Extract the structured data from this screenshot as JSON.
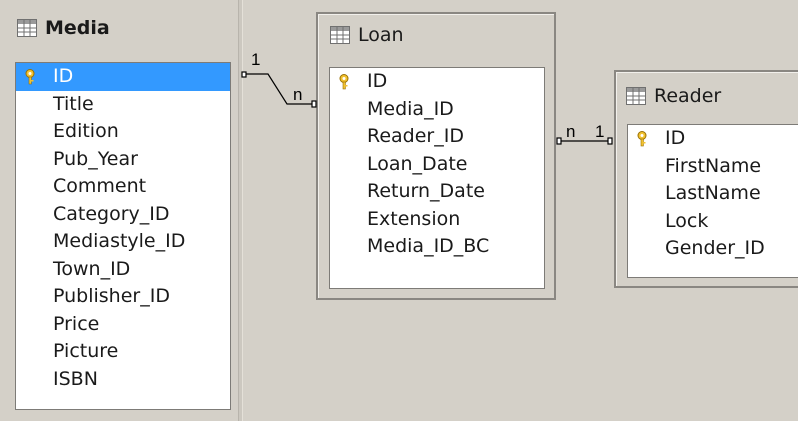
{
  "tables": [
    {
      "title": "Media",
      "fields": [
        "ID",
        "Title",
        "Edition",
        "Pub_Year",
        "Comment",
        "Category_ID",
        "Mediastyle_ID",
        "Town_ID",
        "Publisher_ID",
        "Price",
        "Picture",
        "ISBN"
      ],
      "selected_field": "ID"
    },
    {
      "title": "Loan",
      "fields": [
        "ID",
        "Media_ID",
        "Reader_ID",
        "Loan_Date",
        "Return_Date",
        "Extension",
        "Media_ID_BC"
      ]
    },
    {
      "title": "Reader",
      "fields": [
        "ID",
        "FirstName",
        "LastName",
        "Lock",
        "Gender_ID"
      ]
    }
  ],
  "relations": [
    {
      "from": "Media.ID",
      "to": "Loan.Media_ID",
      "from_card": "1",
      "to_card": "n"
    },
    {
      "from": "Loan.Reader_ID",
      "to": "Reader.ID",
      "from_card": "n",
      "to_card": "1"
    }
  ],
  "icons": {
    "table": "table-icon",
    "key": "primary-key-icon"
  },
  "colors": {
    "selection": "#3399ff",
    "background": "#d4d0c8"
  }
}
